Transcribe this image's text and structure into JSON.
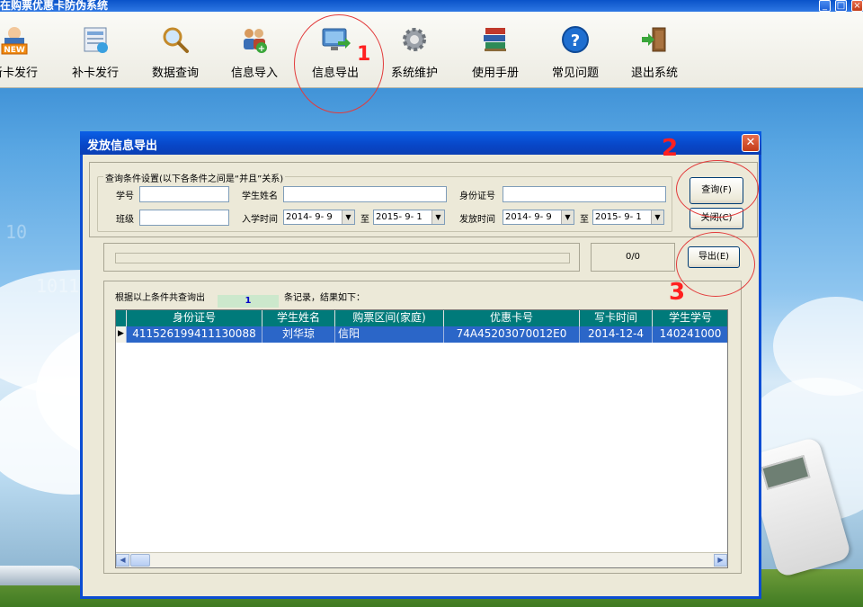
{
  "window": {
    "title": "在购票优惠卡防伪系统"
  },
  "toolbar": {
    "items": [
      {
        "label": "新卡发行",
        "icon": "new-card-icon"
      },
      {
        "label": "补卡发行",
        "icon": "reissue-card-icon"
      },
      {
        "label": "数据查询",
        "icon": "magnifier-icon"
      },
      {
        "label": "信息导入",
        "icon": "users-add-icon"
      },
      {
        "label": "信息导出",
        "icon": "monitor-export-icon"
      },
      {
        "label": "系统维护",
        "icon": "gear-icon"
      },
      {
        "label": "使用手册",
        "icon": "books-icon"
      },
      {
        "label": "常见问题",
        "icon": "question-icon"
      },
      {
        "label": "退出系统",
        "icon": "exit-door-icon"
      }
    ]
  },
  "dialog": {
    "title": "发放信息导出",
    "query_group_label": "查询条件设置(以下各条件之间是“并且”关系)",
    "fields": {
      "student_no_label": "学号",
      "student_name_label": "学生姓名",
      "id_no_label": "身份证号",
      "class_label": "班级",
      "enroll_time_label": "入学时间",
      "enroll_from": "2014- 9- 9",
      "to_label_1": "至",
      "enroll_to": "2015- 9- 1",
      "issue_time_label": "发放时间",
      "issue_from": "2014- 9- 9",
      "to_label_2": "至",
      "issue_to": "2015- 9- 1"
    },
    "buttons": {
      "query": "查询(F)",
      "close": "关闭(C)",
      "export": "导出(E)"
    },
    "progress": {
      "value": 0,
      "label": "0/0"
    },
    "result_prefix": "根据以上条件共查询出",
    "result_count": "1",
    "result_suffix": "条记录，结果如下：",
    "grid": {
      "columns": [
        "身份证号",
        "学生姓名",
        "购票区间(家庭)",
        "优惠卡号",
        "写卡时间",
        "学生学号"
      ],
      "rows": [
        [
          "411526199411130088",
          "刘华琼",
          "信阳",
          "74A45203070012E0",
          "2014-12-4",
          "140241000"
        ]
      ]
    }
  },
  "annotations": {
    "mark_1": "1",
    "mark_2": "2",
    "mark_3": "3"
  },
  "colors": {
    "header_teal": "#007a7a",
    "selected_row": "#2b66c8",
    "xp_title": "#0a5fe6",
    "annotation_red": "#ff2020"
  }
}
